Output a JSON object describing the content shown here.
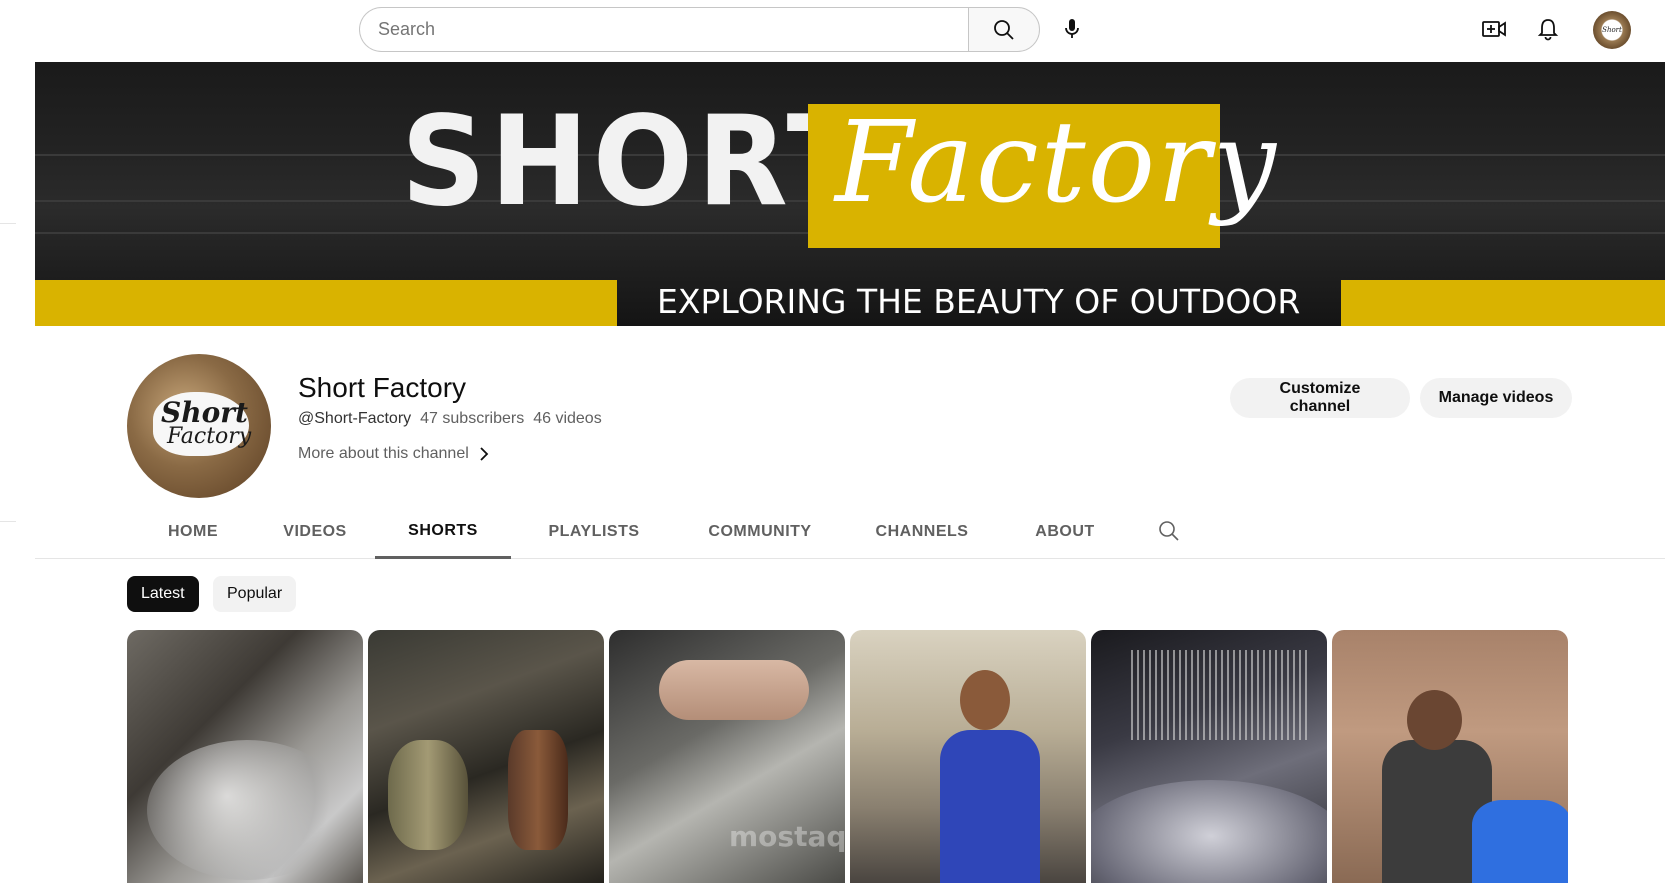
{
  "topbar": {
    "search_placeholder": "Search",
    "icons": [
      "search-icon",
      "mic-icon",
      "create-video-icon",
      "bell-icon",
      "account-avatar"
    ]
  },
  "banner": {
    "title_left": "SHORT",
    "title_right": "Factory",
    "tagline": "EXPLORING THE BEAUTY OF OUTDOOR",
    "accent_color": "#d9b300"
  },
  "channel": {
    "name": "Short Factory",
    "handle": "@Short-Factory",
    "subscribers": "47 subscribers",
    "videos": "46 videos",
    "more_about": "More about this channel",
    "avatar_text_1": "Short",
    "avatar_text_2": "Factory",
    "buttons": {
      "customize": "Customize channel",
      "manage": "Manage videos"
    }
  },
  "tabs": [
    {
      "label": "HOME",
      "active": false
    },
    {
      "label": "VIDEOS",
      "active": false
    },
    {
      "label": "SHORTS",
      "active": true
    },
    {
      "label": "PLAYLISTS",
      "active": false
    },
    {
      "label": "COMMUNITY",
      "active": false
    },
    {
      "label": "CHANNELS",
      "active": false
    },
    {
      "label": "ABOUT",
      "active": false
    }
  ],
  "chips": [
    {
      "label": "Latest",
      "active": true
    },
    {
      "label": "Popular",
      "active": false
    }
  ],
  "shorts": [
    {
      "thumb": "metal-pipe-closeup"
    },
    {
      "thumb": "machine-gears"
    },
    {
      "thumb": "hand-engraving-metal"
    },
    {
      "thumb": "worker-factory-floor"
    },
    {
      "thumb": "loom-threads"
    },
    {
      "thumb": "worker-blue-canister"
    }
  ],
  "watermark_text": "mostaql"
}
